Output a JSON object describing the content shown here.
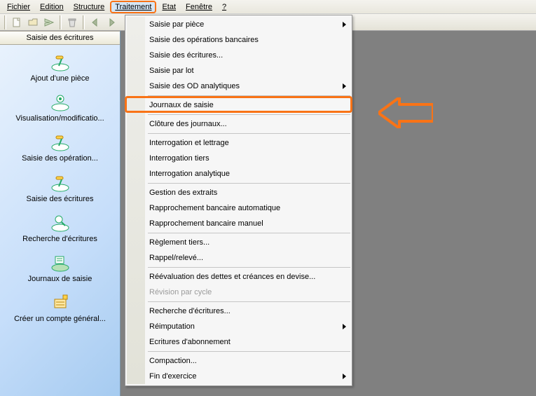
{
  "menubar": [
    "Fichier",
    "Edition",
    "Structure",
    "Traitement",
    "Etat",
    "Fenêtre",
    "?"
  ],
  "menubar_active_index": 3,
  "sidebar": {
    "header": "Saisie des écritures",
    "items": [
      {
        "label": "Ajout d'une pièce",
        "icon": "add-piece"
      },
      {
        "label": "Visualisation/modificatio...",
        "icon": "view-modify"
      },
      {
        "label": "Saisie des opération...",
        "icon": "ops"
      },
      {
        "label": "Saisie des écritures",
        "icon": "entries"
      },
      {
        "label": "Recherche d'écritures",
        "icon": "search"
      },
      {
        "label": "Journaux de saisie",
        "icon": "journal"
      },
      {
        "label": "Créer un compte général...",
        "icon": "account"
      }
    ]
  },
  "dropdown": {
    "items": [
      {
        "label": "Saisie par pièce",
        "sub": true
      },
      {
        "label": "Saisie des opérations bancaires"
      },
      {
        "label": "Saisie des écritures..."
      },
      {
        "label": "Saisie par lot"
      },
      {
        "label": "Saisie des OD analytiques",
        "sub": true
      },
      {
        "sep": true
      },
      {
        "label": "Journaux de saisie",
        "highlight": true
      },
      {
        "sep": true
      },
      {
        "label": "Clôture des journaux..."
      },
      {
        "sep": true
      },
      {
        "label": "Interrogation et lettrage"
      },
      {
        "label": "Interrogation tiers"
      },
      {
        "label": "Interrogation analytique"
      },
      {
        "sep": true
      },
      {
        "label": "Gestion des extraits"
      },
      {
        "label": "Rapprochement bancaire automatique"
      },
      {
        "label": "Rapprochement bancaire manuel"
      },
      {
        "sep": true
      },
      {
        "label": "Règlement tiers..."
      },
      {
        "label": "Rappel/relevé..."
      },
      {
        "sep": true
      },
      {
        "label": "Réévaluation des dettes et créances en devise..."
      },
      {
        "label": "Révision par cycle",
        "disabled": true
      },
      {
        "sep": true
      },
      {
        "label": "Recherche d'écritures..."
      },
      {
        "label": "Réimputation",
        "sub": true
      },
      {
        "label": "Ecritures d'abonnement"
      },
      {
        "sep": true
      },
      {
        "label": "Compaction..."
      },
      {
        "label": "Fin d'exercice",
        "sub": true
      }
    ]
  },
  "colors": {
    "accent": "#f97316"
  }
}
